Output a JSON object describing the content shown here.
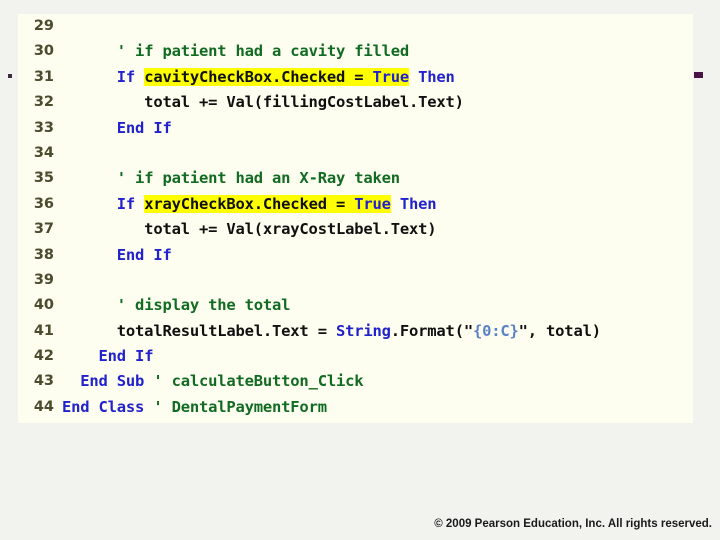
{
  "slide": {
    "panel_bg": "#fdfdf0",
    "page_bg": "#f2f2ee",
    "highlight_color": "#ffff00",
    "keyword_color": "#2222cc",
    "comment_color": "#126b22",
    "string_color": "#5a82c8",
    "plain_color": "#101010",
    "lineno_color": "#4b4b2e"
  },
  "code": {
    "language": "Visual Basic",
    "first_line_number": 29,
    "last_line_number": 44,
    "lines": [
      {
        "no": "29",
        "text": ""
      },
      {
        "no": "30",
        "text": "        ' if patient had a cavity filled"
      },
      {
        "no": "31",
        "text": "        If cavityCheckBox.Checked = True Then"
      },
      {
        "no": "32",
        "text": "            total += Val(fillingCostLabel.Text)"
      },
      {
        "no": "33",
        "text": "        End If"
      },
      {
        "no": "34",
        "text": ""
      },
      {
        "no": "35",
        "text": "        ' if patient had an X-Ray taken"
      },
      {
        "no": "36",
        "text": "        If xrayCheckBox.Checked = True Then"
      },
      {
        "no": "37",
        "text": "            total += Val(xrayCostLabel.Text)"
      },
      {
        "no": "38",
        "text": "        End If"
      },
      {
        "no": "39",
        "text": ""
      },
      {
        "no": "40",
        "text": "        ' display the total"
      },
      {
        "no": "41",
        "text": "        totalResultLabel.Text = String.Format(\"{0:C}\", total)"
      },
      {
        "no": "42",
        "text": "      End If"
      },
      {
        "no": "43",
        "text": "   End Sub ' calculateButton_Click"
      },
      {
        "no": "44",
        "text": "End Class ' DentalPaymentForm"
      }
    ],
    "highlighted_fragments": [
      "cavityCheckBox.Checked = True",
      "xrayCheckBox.Checked = True"
    ]
  },
  "footer": {
    "copyright": "© 2009 Pearson Education, Inc.  All rights reserved."
  }
}
